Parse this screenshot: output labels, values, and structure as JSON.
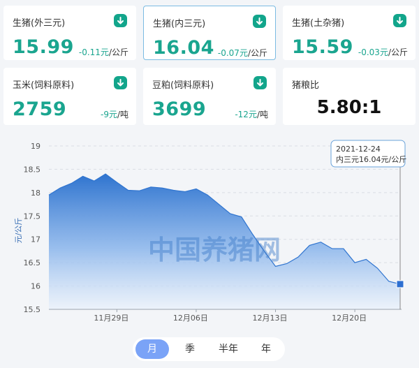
{
  "cards": [
    {
      "title": "生猪(外三元)",
      "price": "15.99",
      "change": "-0.11元",
      "unit": "/公斤",
      "icon": "down-arrow-icon"
    },
    {
      "title": "生猪(内三元)",
      "price": "16.04",
      "change": "-0.07元",
      "unit": "/公斤",
      "icon": "down-arrow-icon"
    },
    {
      "title": "生猪(土杂猪)",
      "price": "15.59",
      "change": "-0.03元",
      "unit": "/公斤",
      "icon": "down-arrow-icon"
    },
    {
      "title": "玉米(饲料原料)",
      "price": "2759",
      "change": "-9元",
      "unit": "/吨",
      "icon": "down-arrow-icon"
    },
    {
      "title": "豆粕(饲料原料)",
      "price": "3699",
      "change": "-12元",
      "unit": "/吨",
      "icon": "down-arrow-icon"
    }
  ],
  "ratio_card": {
    "title": "猪粮比",
    "value": "5.80:1"
  },
  "colors": {
    "accent_green": "#1aa58f",
    "chart_blue": "#3b7fd6",
    "tab_active": "#7aa3f7"
  },
  "chart_data": {
    "type": "area",
    "ylabel": "元/公斤",
    "ylim": [
      15.5,
      19
    ],
    "yticks": [
      "19",
      "18.5",
      "18",
      "17.5",
      "17",
      "16.5",
      "16",
      "15.5"
    ],
    "xticks": [
      {
        "day": 6,
        "label": "11月29日"
      },
      {
        "day": 13,
        "label": "12月06日"
      },
      {
        "day": 20,
        "label": "12月13日"
      },
      {
        "day": 27,
        "label": "12月20日"
      }
    ],
    "x_start_date": "2021-11-23",
    "grid": true,
    "watermark": "中国养猪网",
    "tooltip": {
      "date": "2021-12-24",
      "text": "内三元16.04元/公斤"
    },
    "series": [
      {
        "name": "内三元",
        "points": [
          [
            0,
            17.95
          ],
          [
            1,
            18.1
          ],
          [
            2,
            18.2
          ],
          [
            3,
            18.35
          ],
          [
            4,
            18.25
          ],
          [
            5,
            18.4
          ],
          [
            6,
            18.22
          ],
          [
            7,
            18.05
          ],
          [
            8,
            18.04
          ],
          [
            9,
            18.12
          ],
          [
            10,
            18.1
          ],
          [
            11,
            18.05
          ],
          [
            12,
            18.02
          ],
          [
            13,
            18.08
          ],
          [
            14,
            17.95
          ],
          [
            15,
            17.75
          ],
          [
            16,
            17.55
          ],
          [
            17,
            17.48
          ],
          [
            18,
            17.1
          ],
          [
            19,
            16.75
          ],
          [
            20,
            16.42
          ],
          [
            21,
            16.48
          ],
          [
            22,
            16.62
          ],
          [
            23,
            16.87
          ],
          [
            24,
            16.94
          ],
          [
            25,
            16.8
          ],
          [
            26,
            16.8
          ],
          [
            27,
            16.5
          ],
          [
            28,
            16.57
          ],
          [
            29,
            16.38
          ],
          [
            30,
            16.1
          ],
          [
            31,
            16.04
          ]
        ]
      }
    ]
  },
  "range_tabs": [
    {
      "label": "月",
      "active": true
    },
    {
      "label": "季",
      "active": false
    },
    {
      "label": "半年",
      "active": false
    },
    {
      "label": "年",
      "active": false
    }
  ]
}
